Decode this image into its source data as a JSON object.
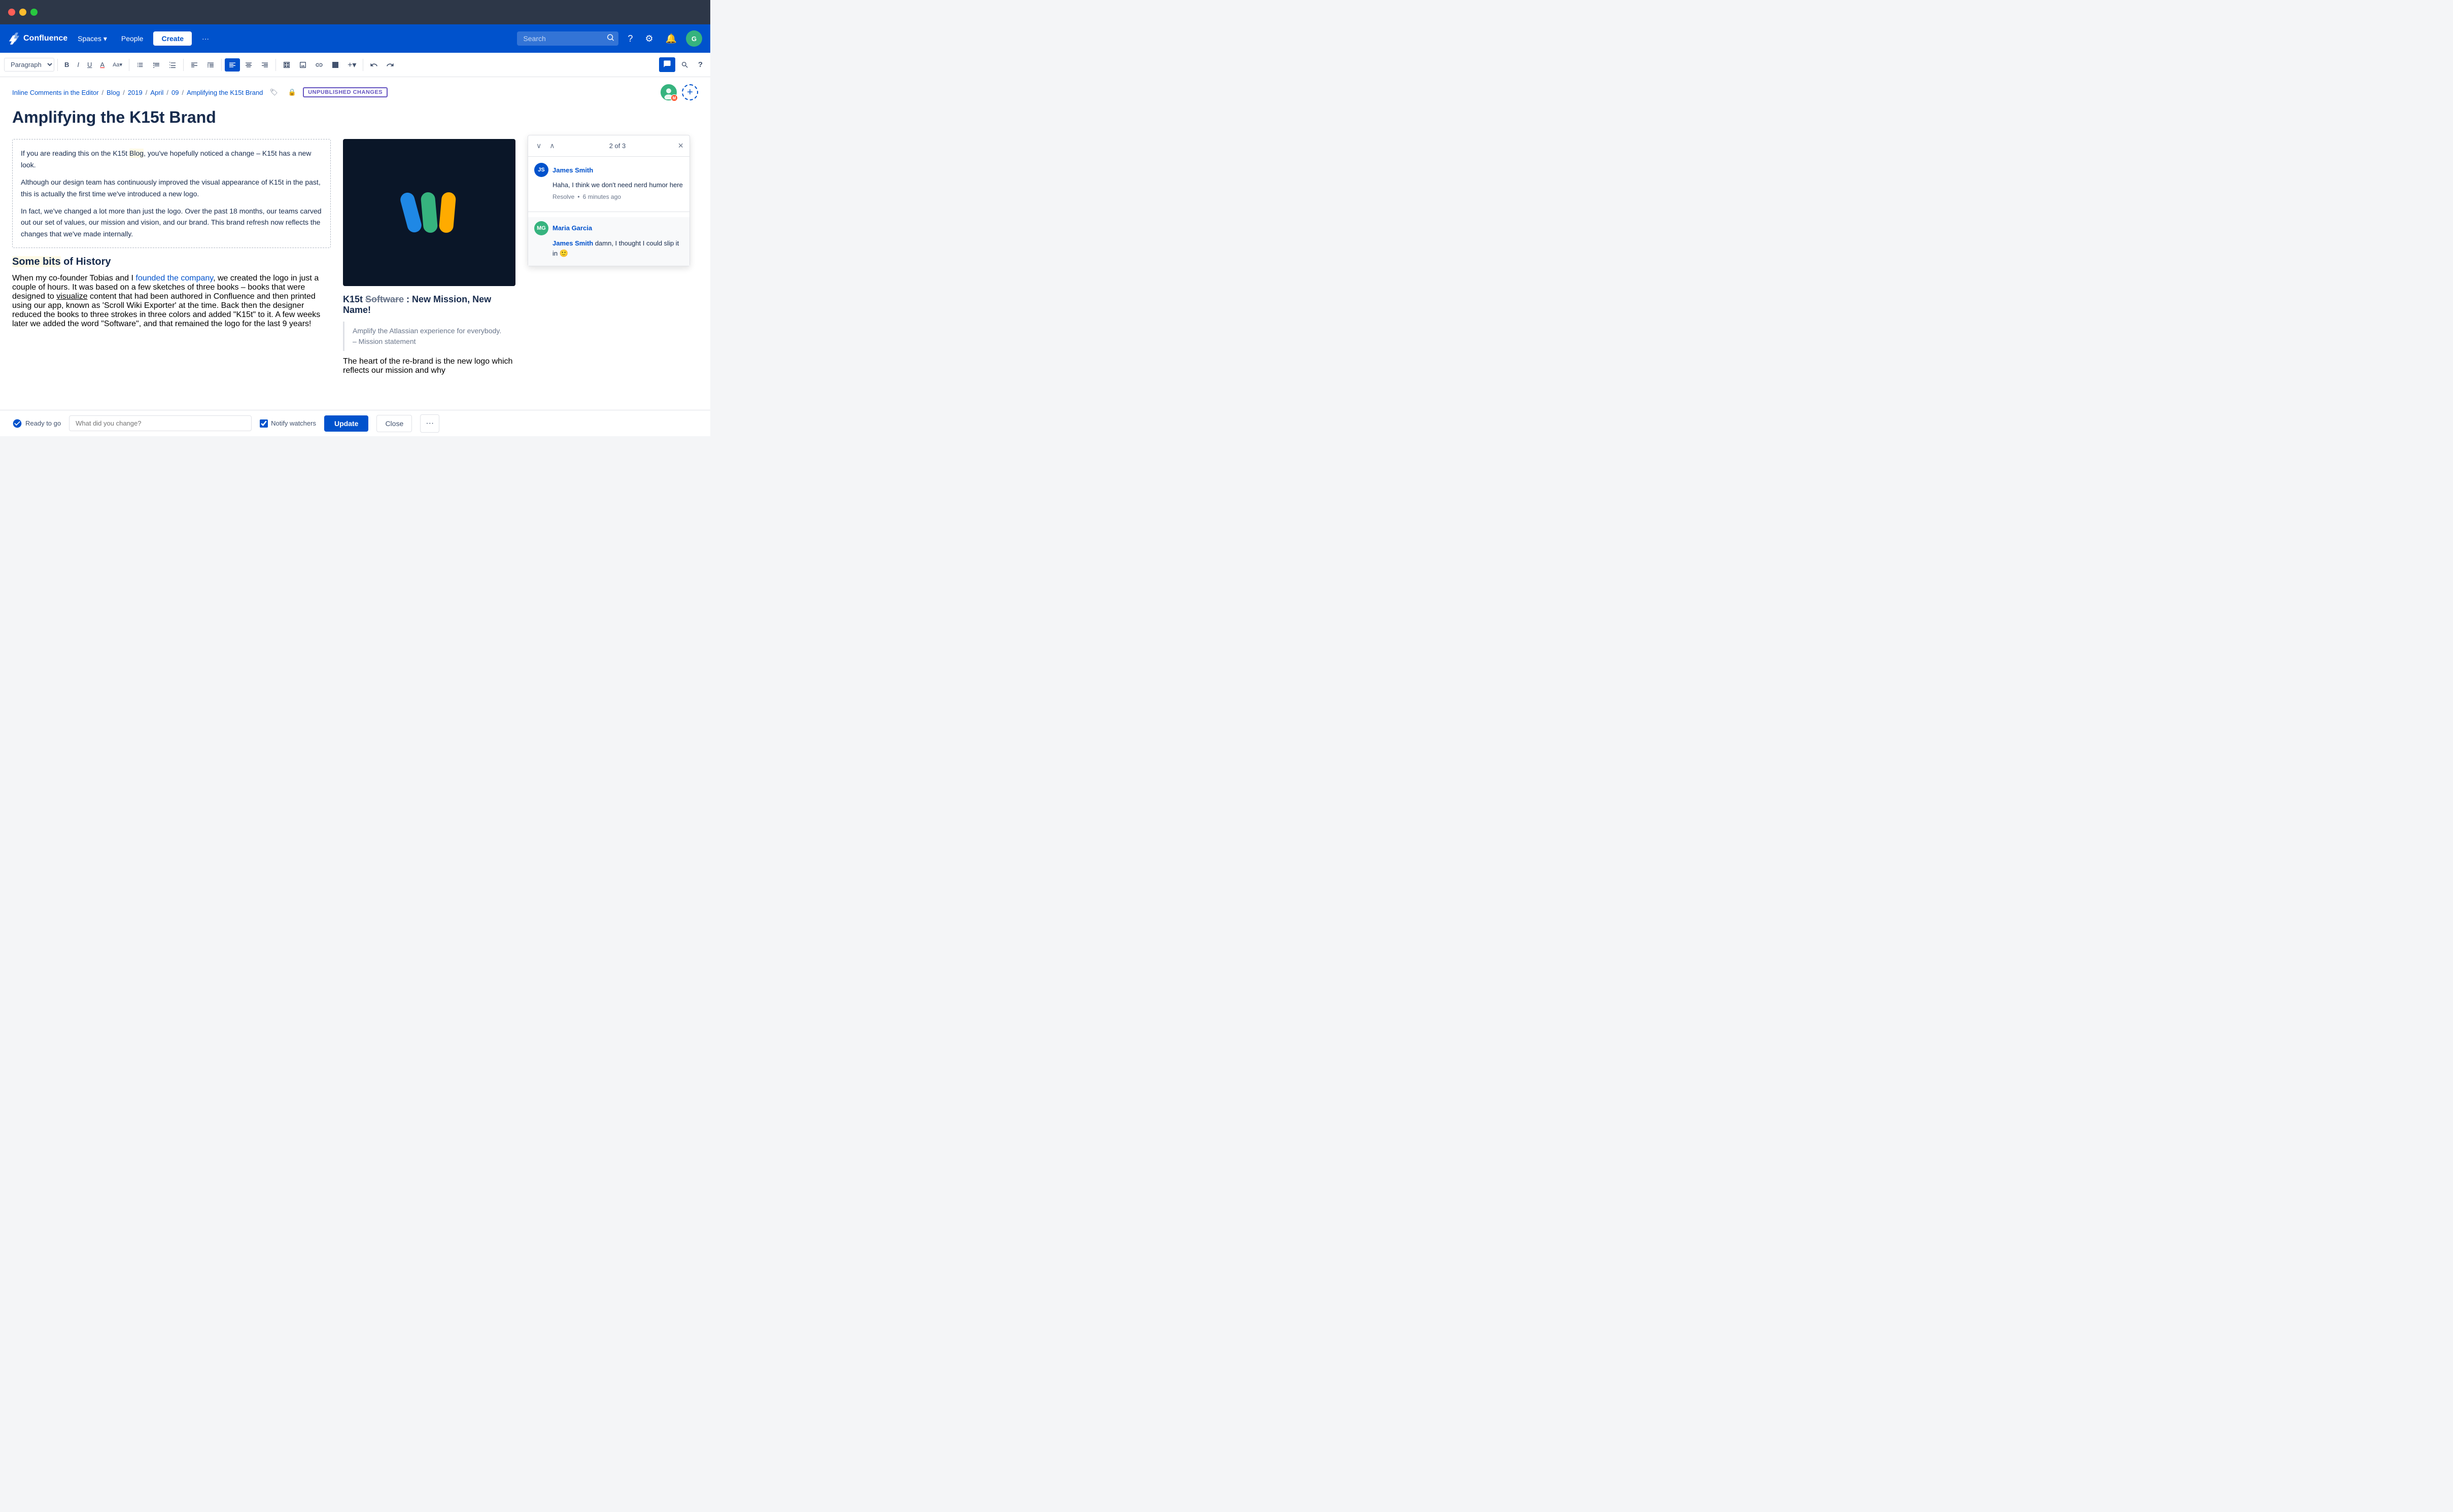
{
  "titlebar": {
    "traffic_lights": [
      "red",
      "yellow",
      "green"
    ]
  },
  "navbar": {
    "logo_text": "Confluence",
    "spaces_label": "Spaces",
    "people_label": "People",
    "create_label": "Create",
    "more_label": "···",
    "search_placeholder": "Search",
    "search_value": "Search",
    "help_icon": "?",
    "settings_icon": "⚙",
    "notifications_icon": "🔔",
    "avatar_initials": "G"
  },
  "toolbar": {
    "paragraph_label": "Paragraph",
    "bold": "B",
    "italic": "I",
    "underline": "U",
    "text_color": "A",
    "formatting": "Aa",
    "bullet_list": "≡",
    "numbered_list": "≡",
    "task_list": "☑",
    "indent_less": "⇤",
    "indent_more": "⇥",
    "align_left": "≡",
    "align_center": "≡",
    "align_right": "≡",
    "layout": "⊞",
    "image": "🖼",
    "link": "🔗",
    "table": "⊞",
    "insert_plus": "+",
    "undo": "↩",
    "redo": "↪",
    "comment_icon": "💬",
    "find_icon": "🔍",
    "help_icon": "?"
  },
  "breadcrumb": {
    "items": [
      {
        "label": "Inline Comments in the Editor",
        "href": "#"
      },
      {
        "label": "Blog",
        "href": "#"
      },
      {
        "label": "2019",
        "href": "#"
      },
      {
        "label": "April",
        "href": "#"
      },
      {
        "label": "09",
        "href": "#"
      },
      {
        "label": "Amplifying the K15t Brand",
        "href": "#"
      }
    ],
    "unpublished_badge": "UNPUBLISHED CHANGES",
    "add_button": "+"
  },
  "editor": {
    "page_title": "Amplifying the K15t Brand",
    "body_paragraphs": [
      "If you are reading this on the K15t Blog, you've hopefully noticed a change – K15t has a new look.",
      "Although our design team has continuously improved the visual appearance of K15t in the past, this is actually the first time we've introduced a new logo.",
      "In fact, we've changed a lot more than just the logo. Over the past 18 months, our teams carved out our set of values, our mission and vision, and our brand. This brand refresh now reflects the changes that we've made internally."
    ],
    "highlighted_word_1": "Blog",
    "subheading": "Some bits",
    "subheading_rest": " of History",
    "history_paragraph": "When my co-founder Tobias and I founded the company, we created the logo in just a couple of hours. It was based on a few sketches of three books – books that were designed to visualize content that had been authored in Confluence and then printed using our app, known as 'Scroll Wiki Exporter' at the time. Back then the designer reduced the books to three strokes in three colors and added \"K15t\" to it. A few weeks later we added the word \"Software\", and that remained the logo for the last 9 years!",
    "link_text": "founded the company",
    "underline_word": "visualize",
    "image_caption_title_prefix": "K15t ",
    "image_caption_strikethrough": "Software",
    "image_caption_title_suffix": ": New Mission, New Name!",
    "mission_statement_1": "Amplify the Atlassian experience for everybody.",
    "mission_statement_2": "– Mission statement",
    "body_extra": "The heart of the re-brand is the new logo which reflects our mission and why"
  },
  "comment_panel": {
    "counter": "2 of 3",
    "nav_up": "∧",
    "nav_down": "∨",
    "close": "×",
    "thread_1": {
      "avatar_initials": "JS",
      "avatar_color": "blue",
      "username": "James Smith",
      "text": "Haha, I think we don't need nerd humor here",
      "resolve_label": "Resolve",
      "time_ago": "6 minutes ago",
      "dot": "•"
    },
    "thread_2": {
      "avatar_initials": "MG",
      "avatar_color": "green",
      "username": "Maria Garcia",
      "mention_user": "James Smith",
      "text_after": " damn, I thought I could slip it in",
      "emoji": "🙂"
    }
  },
  "bottom_bar": {
    "ready_label": "Ready to go",
    "change_placeholder": "What did you change?",
    "notify_label": "Notify watchers",
    "update_label": "Update",
    "close_label": "Close",
    "more_label": "···"
  }
}
